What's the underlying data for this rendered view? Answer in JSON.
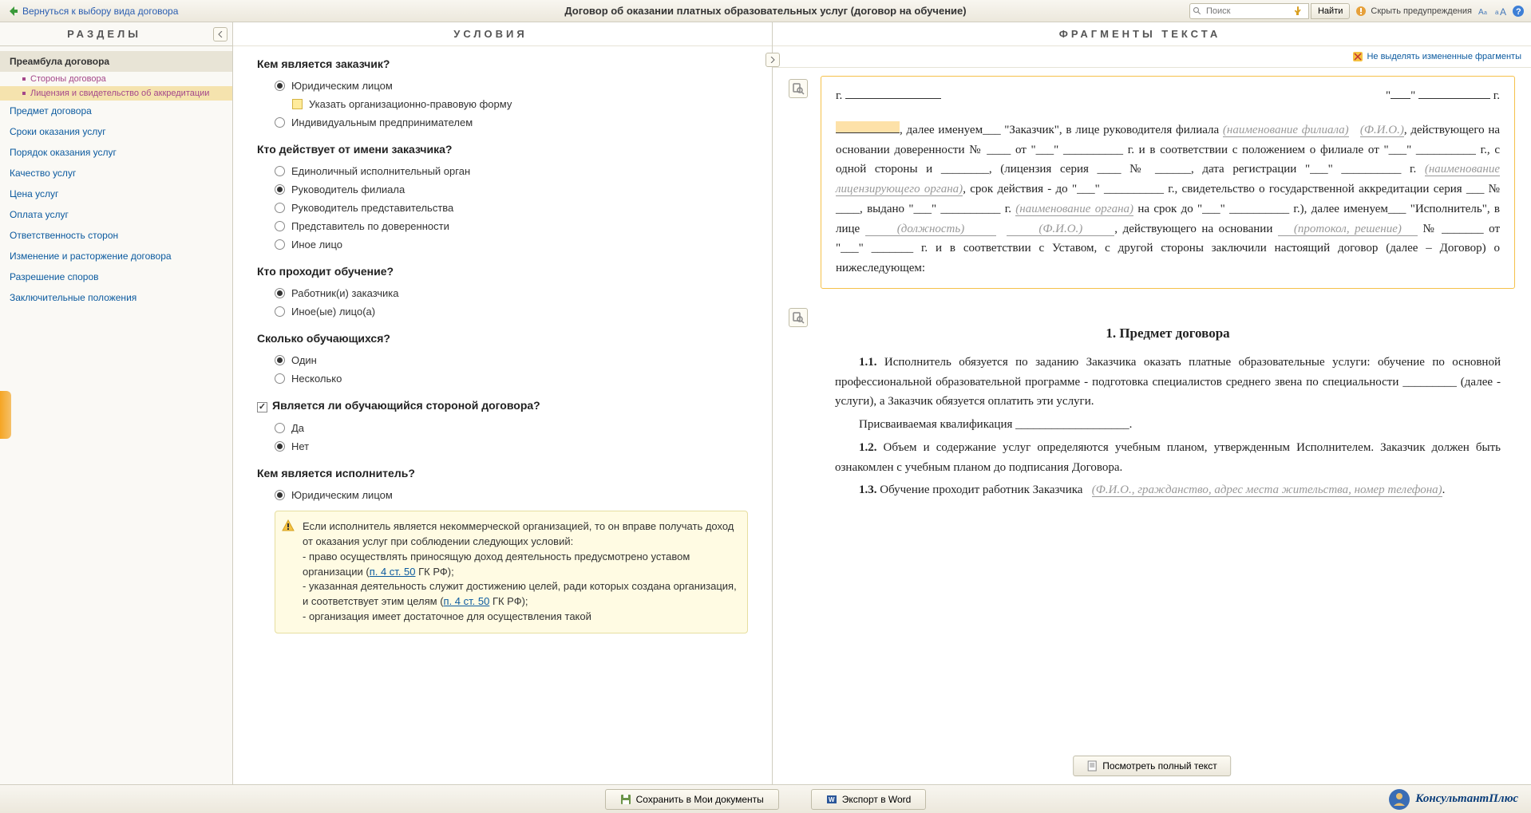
{
  "header": {
    "back_label": "Вернуться к выбору вида договора",
    "title": "Договор об оказании платных образовательных услуг (договор на обучение)",
    "search_placeholder": "Поиск",
    "find_label": "Найти",
    "hide_warnings_label": "Скрыть предупреждения"
  },
  "sections": {
    "panel_title": "РАЗДЕЛЫ",
    "items": [
      {
        "label": "Преамбула договора",
        "active": true,
        "subs": [
          {
            "label": "Стороны договора",
            "hl": false
          },
          {
            "label": "Лицензия и свидетельство об аккредитации",
            "hl": true
          }
        ]
      },
      {
        "label": "Предмет договора"
      },
      {
        "label": "Сроки оказания услуг"
      },
      {
        "label": "Порядок оказания услуг"
      },
      {
        "label": "Качество услуг"
      },
      {
        "label": "Цена услуг"
      },
      {
        "label": "Оплата услуг"
      },
      {
        "label": "Ответственность сторон"
      },
      {
        "label": "Изменение и расторжение договора"
      },
      {
        "label": "Разрешение споров"
      },
      {
        "label": "Заключительные положения"
      }
    ]
  },
  "conditions": {
    "panel_title": "УСЛОВИЯ",
    "q1": {
      "title": "Кем является заказчик?",
      "o1": "Юридическим лицом",
      "o1a": "Указать организационно-правовую форму",
      "o2": "Индивидуальным предпринимателем"
    },
    "q2": {
      "title": "Кто действует от имени заказчика?",
      "o1": "Единоличный исполнительный орган",
      "o2": "Руководитель филиала",
      "o3": "Руководитель представительства",
      "o4": "Представитель по доверенности",
      "o5": "Иное лицо"
    },
    "q3": {
      "title": "Кто проходит обучение?",
      "o1": "Работник(и) заказчика",
      "o2": "Иное(ые) лицо(а)"
    },
    "q4": {
      "title": "Сколько обучающихся?",
      "o1": "Один",
      "o2": "Несколько"
    },
    "q5": {
      "title": "Является ли обучающийся стороной договора?",
      "o1": "Да",
      "o2": "Нет"
    },
    "q6": {
      "title": "Кем является исполнитель?",
      "o1": "Юридическим лицом"
    },
    "warning": {
      "line1": "Если исполнитель является некоммерческой организацией, то он вправе получать доход от оказания услуг при соблюдении следующих условий:",
      "b1a": "- право осуществлять приносящую доход деятельность предусмотрено уставом организации (",
      "b1link": "п. 4 ст. 50",
      "b1b": " ГК РФ);",
      "b2a": "- указанная деятельность служит достижению целей, ради которых создана организация, и соответствует этим целям (",
      "b2link": "п. 4 ст. 50",
      "b2b": " ГК РФ);",
      "b3": "- организация имеет достаточное для осуществления такой"
    }
  },
  "fragments": {
    "panel_title": "ФРАГМЕНТЫ ТЕКСТА",
    "toggle_highlight": "Не выделять измененные фрагменты",
    "view_full": "Посмотреть полный текст",
    "f1": {
      "city_prefix": "г.",
      "date_suffix": "г.",
      "t1": ", далее именуем___ \"Заказчик\", в лице руководителя филиала ",
      "h_branch": "(наименование филиала)",
      "h_fio": "(Ф.И.О.)",
      "t2": ", действующего на основании доверенности № ____ от \"___\" __________ г. и  в соответствии с положением о филиале от \"___\" __________ г., с одной стороны и ________, (лицензия серия ____ № ______, дата регистрации \"___\" __________ г.  ",
      "h_lic": "(наименование лицензирующего органа)",
      "t3": ", срок действия - до \"___\" __________ г., свидетельство о государственной аккредитации серия ___ № ____, выдано \"___\" __________ г. ",
      "h_org": "(наименование органа)",
      "t4": "  на срок до \"___\" __________ г.), далее  именуем___ \"Исполнитель\", в лице ",
      "h_post": "(должность)",
      "h_fio2": "(Ф.И.О.)",
      "t5": ", действующего на основании ",
      "h_proto": "(протокол, решение)",
      "t6": " № _______ от \"___\" _______ г. и в соответствии с Уставом, с другой стороны заключили настоящий договор (далее – Договор) о нижеследующем:"
    },
    "f2": {
      "title": "1. Предмет договора",
      "p11a": "1.1.",
      "p11b": " Исполнитель обязуется по заданию Заказчика оказать платные образовательные услуги: обучение по основной профессиональной образовательной программе - подготовка специалистов среднего звена по специальности _________ (далее - услуги), а Заказчик обязуется оплатить эти услуги.",
      "p_qual": "Присваиваемая квалификация ___________________.",
      "p12a": "1.2.",
      "p12b": " Объем и содержание услуг определяются учебным планом, утвержденным Исполнителем. Заказчик должен быть ознакомлен с учебным планом до подписания Договора.",
      "p13a": "1.3.",
      "p13b": " Обучение проходит работник Заказчика ",
      "p13hint": "(Ф.И.О., гражданство, адрес места жительства, номер телефона)",
      "p13c": "."
    }
  },
  "footer": {
    "save_label": "Сохранить в Мои документы",
    "export_label": "Экспорт в Word",
    "brand": "КонсультантПлюс"
  }
}
